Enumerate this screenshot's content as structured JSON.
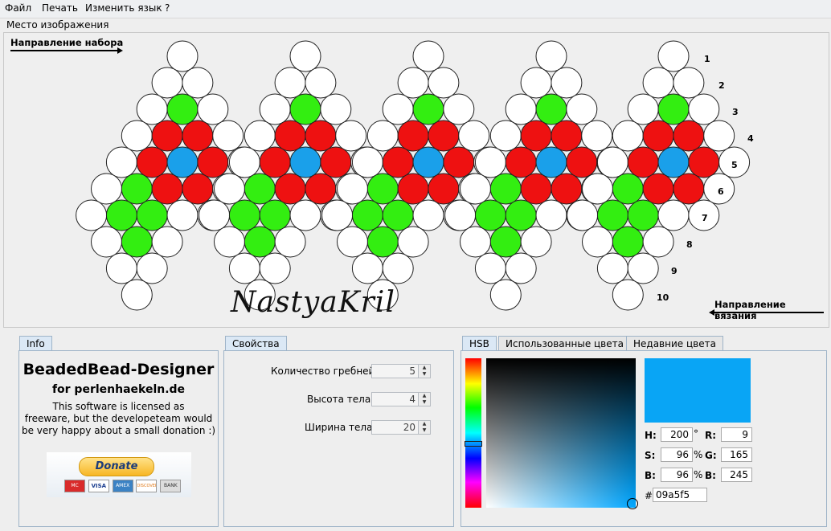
{
  "menu": {
    "file": "Файл",
    "print": "Печать",
    "language": "Изменить язык",
    "help": "?"
  },
  "canvas": {
    "section_title": "Место изображения",
    "direction_set": "Направление набора",
    "direction_knit": "Направление вязания",
    "signature": "NastyaKril",
    "row_numbers": [
      "1",
      "2",
      "3",
      "4",
      "5",
      "6",
      "7",
      "8",
      "9",
      "10"
    ]
  },
  "colors": {
    "white": "#ffffff",
    "green": "#33ee11",
    "red": "#ee1111",
    "blue": "#1aa0ea",
    "selected": "#09a5f5"
  },
  "info": {
    "tab": "Info",
    "title": "BeadedBead-Designer",
    "subtitle": "for perlenhaekeln.de",
    "line1": "This software is licensed as",
    "line2": "freeware, but the developeteam would",
    "line3": "be very happy about a small donation :)",
    "donate": "Donate",
    "cards": [
      "MC",
      "VISA",
      "AMEX",
      "DISCOVER",
      "BANK"
    ]
  },
  "properties": {
    "tab": "Свойства",
    "fields": [
      {
        "label": "Количество гребней",
        "value": "5"
      },
      {
        "label": "Высота тела",
        "value": "4"
      },
      {
        "label": "Ширина тела",
        "value": "20"
      }
    ]
  },
  "color_panel": {
    "tabs": [
      "HSB",
      "Использованные цвета",
      "Недавние цвета"
    ],
    "h_label": "H:",
    "h_value": "200",
    "h_unit": "°",
    "s_label": "S:",
    "s_value": "96",
    "s_unit": "%",
    "b_label": "B:",
    "b_value": "96",
    "b_unit": "%",
    "r_label": "R:",
    "r_value": "9",
    "g_label": "G:",
    "g_value": "165",
    "bl_label": "B:",
    "bl_value": "245",
    "hex_label": "#",
    "hex_value": "09a5f5"
  }
}
